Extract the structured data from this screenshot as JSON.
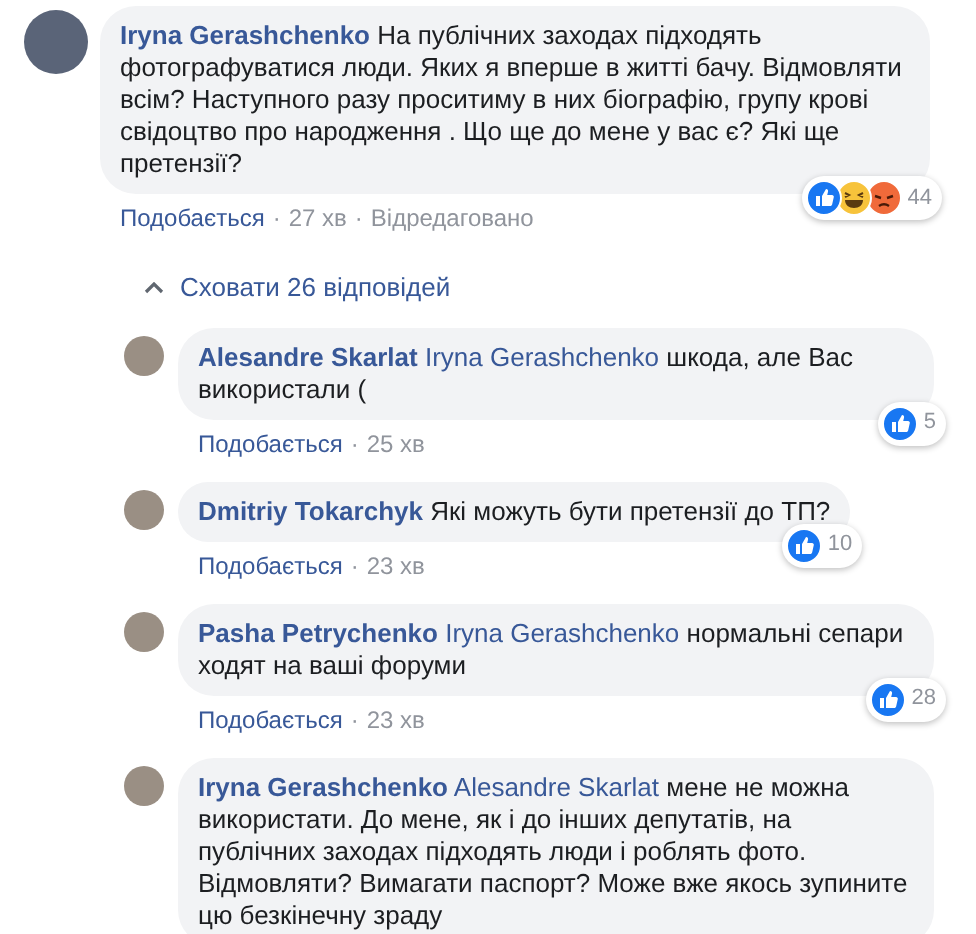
{
  "separator": "·",
  "comments": [
    {
      "author": "Iryna Gerashchenko",
      "text": "На публічних заходах підходять фотографуватися люди. Яких я вперше в житті бачу. Відмовляти всім? Наступного разу проситиму в них біографію, групу крові свідоцтво про народження . Що ще до мене у вас є? Які ще претензії?",
      "actions": [
        "Подобається",
        "27 хв",
        "Відредаговано"
      ],
      "reactions": {
        "kinds": [
          {
            "kind": "like"
          },
          {
            "kind": "haha"
          },
          {
            "kind": "angry"
          }
        ],
        "count": "44"
      },
      "toggle": "Сховати 26 відповідей",
      "replies": [
        {
          "author": "Alesandre Skarlat",
          "mention": "Iryna Gerashchenko",
          "text": "шкода, але Вас використали (",
          "actions": [
            "Подобається",
            "25 хв"
          ],
          "reactions": {
            "kinds": [
              {
                "kind": "like"
              }
            ],
            "count": "5"
          }
        },
        {
          "author": "Dmitriy Tokarchyk",
          "text": "Які можуть бути претензії до ТП?",
          "actions": [
            "Подобається",
            "23 хв"
          ],
          "reactions": {
            "kinds": [
              {
                "kind": "like"
              }
            ],
            "count": "10"
          }
        },
        {
          "author": "Pasha Petrychenko",
          "mention": "Iryna Gerashchenko",
          "text": "нормальні сепари ходят на ваші форуми",
          "actions": [
            "Подобається",
            "23 хв"
          ],
          "reactions": {
            "kinds": [
              {
                "kind": "like"
              }
            ],
            "count": "28"
          }
        },
        {
          "author": "Iryna Gerashchenko",
          "mention": "Alesandre Skarlat",
          "text": "мене не можна використати. До мене, як і до інших депутатів, на публічних заходах підходять люди і роблять фото. Відмовляти? Вимагати паспорт? Може вже якось зупините цю безкінечну зраду"
        }
      ]
    }
  ]
}
